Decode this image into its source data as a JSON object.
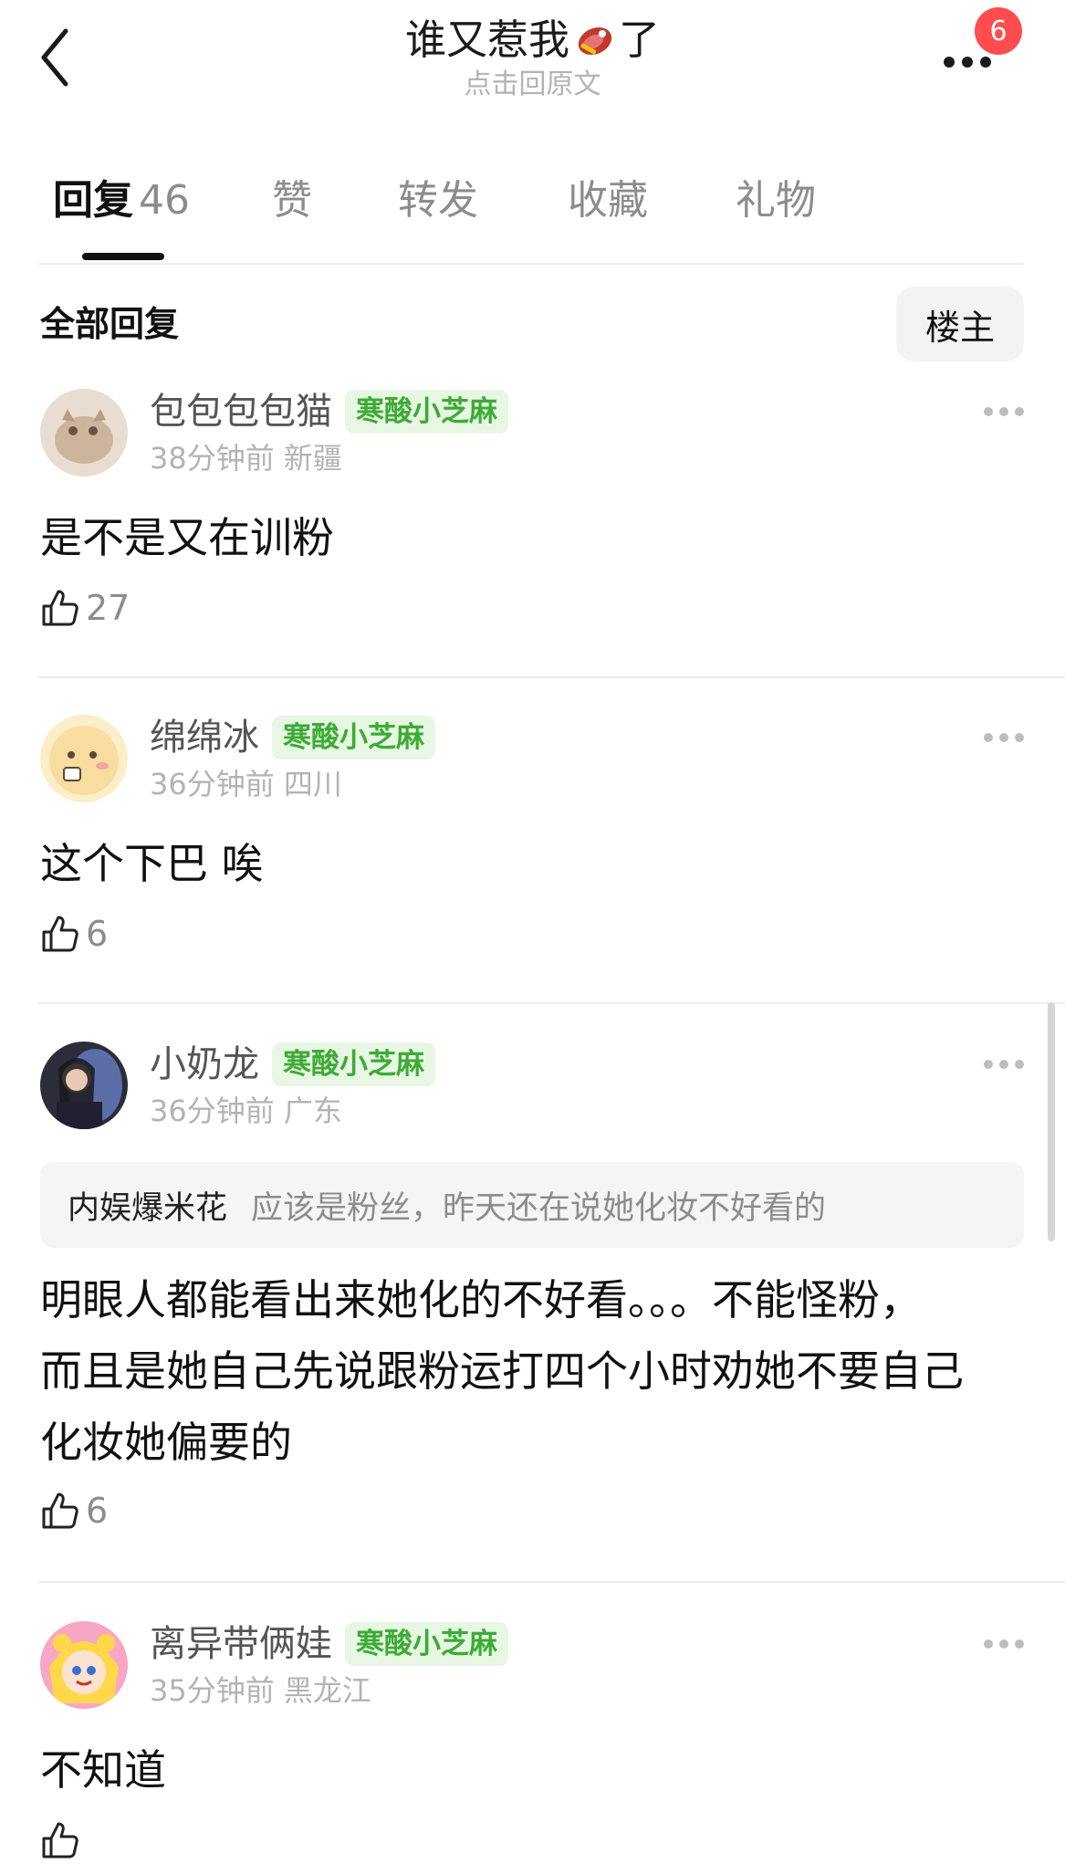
{
  "header": {
    "title_left": "谁又惹我",
    "title_right": "了",
    "subtitle": "点击回原文",
    "badge_count": "6"
  },
  "tabs": [
    {
      "label": "回复",
      "count": "46"
    },
    {
      "label": "赞"
    },
    {
      "label": "转发"
    },
    {
      "label": "收藏"
    },
    {
      "label": "礼物"
    }
  ],
  "filter": {
    "all_label": "全部回复",
    "owner_label": "楼主"
  },
  "comments": [
    {
      "user": "包包包包猫",
      "tag": "寒酸小芝麻",
      "time": "38分钟前",
      "location": "新疆",
      "text": "是不是又在训粉",
      "likes": "27"
    },
    {
      "user": "绵绵冰",
      "tag": "寒酸小芝麻",
      "time": "36分钟前",
      "location": "四川",
      "text": "这个下巴 唉",
      "likes": "6"
    },
    {
      "user": "小奶龙",
      "tag": "寒酸小芝麻",
      "time": "36分钟前",
      "location": "广东",
      "quote_user": "内娱爆米花",
      "quote_text": "应该是粉丝，昨天还在说她化妆不好看的",
      "text_lines": [
        "明眼人都能看出来她化的不好看。。。不能怪粉，",
        "而且是她自己先说跟粉运打四个小时劝她不要自己",
        "化妆她偏要的"
      ],
      "likes": "6"
    },
    {
      "user": "离异带俩娃",
      "tag": "寒酸小芝麻",
      "time": "35分钟前",
      "location": "黑龙江",
      "text": "不知道"
    }
  ],
  "colors": {
    "tag_green": "#3dab35",
    "tag_bg": "#e8f7e4",
    "badge_red": "#ff4d4f"
  }
}
